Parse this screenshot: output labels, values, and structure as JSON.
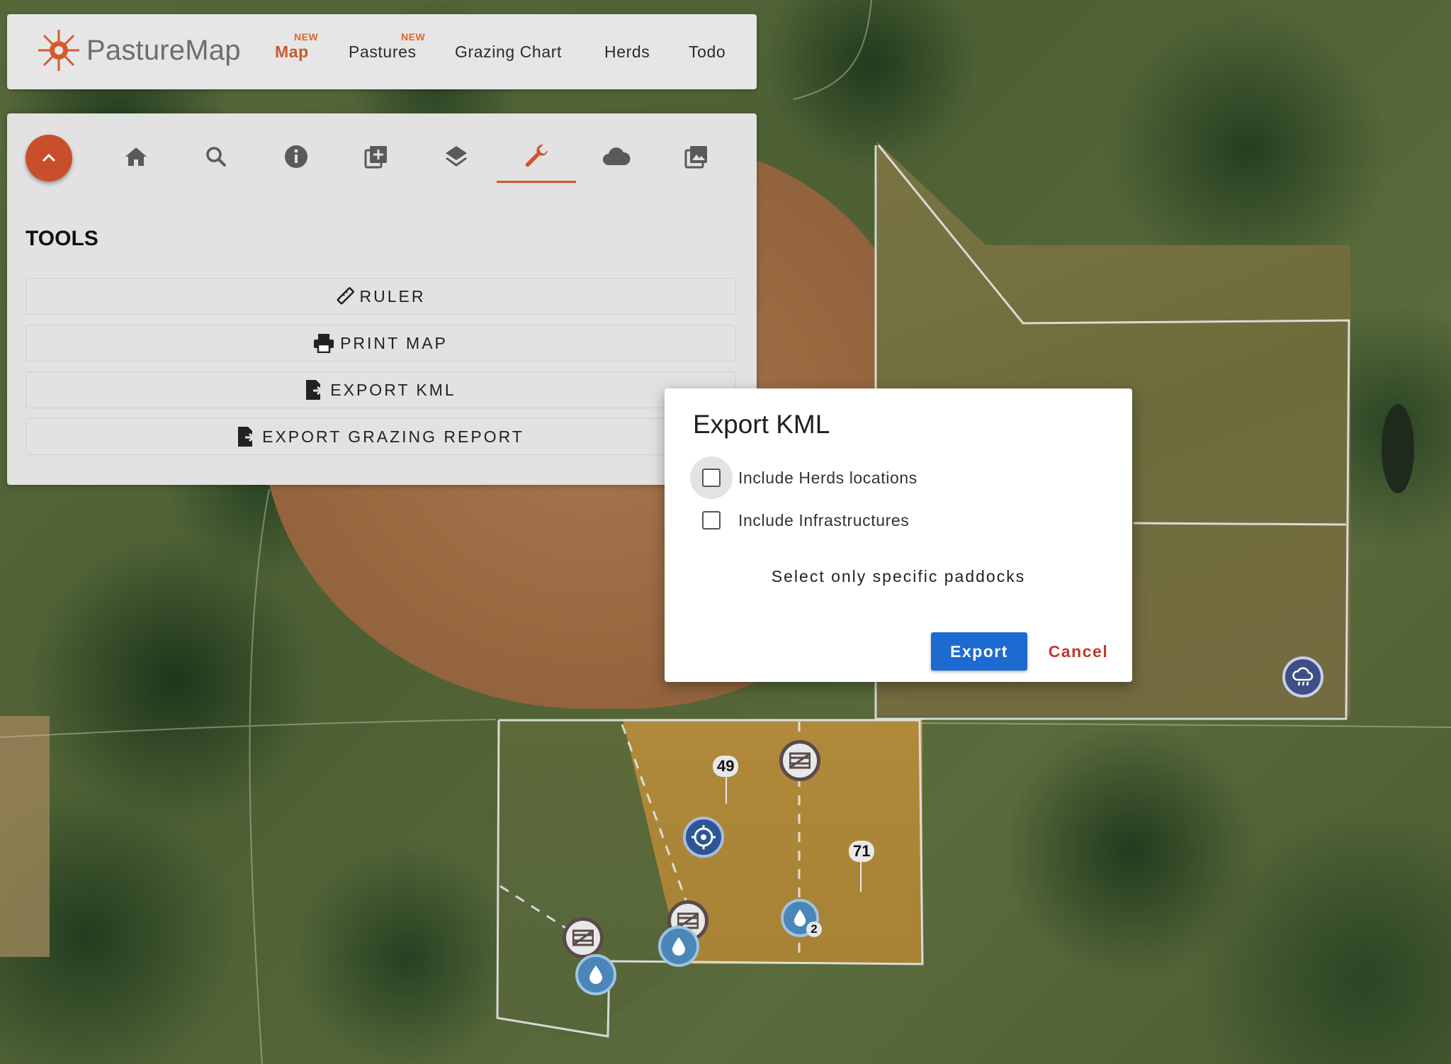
{
  "nav": {
    "logo_text": "PastureMap",
    "items": [
      {
        "label": "Map",
        "badge": "NEW",
        "active": true
      },
      {
        "label": "Pastures",
        "badge": "NEW",
        "active": false
      },
      {
        "label": "Grazing Chart",
        "badge": "",
        "active": false
      },
      {
        "label": "Herds",
        "badge": "",
        "active": false
      },
      {
        "label": "Todo",
        "badge": "",
        "active": false
      }
    ]
  },
  "toolbar": {
    "tabs": [
      "home-icon",
      "search-icon",
      "info-icon",
      "add-layer-icon",
      "layers-icon",
      "wrench-icon",
      "cloud-icon",
      "photo-library-icon"
    ],
    "active_tab": "wrench-icon"
  },
  "tools": {
    "title": "TOOLS",
    "buttons": [
      {
        "label": "RULER",
        "icon": "ruler-icon"
      },
      {
        "label": "PRINT MAP",
        "icon": "printer-icon"
      },
      {
        "label": "EXPORT KML",
        "icon": "file-export-icon"
      },
      {
        "label": "EXPORT GRAZING REPORT",
        "icon": "file-export-icon"
      }
    ]
  },
  "dialog": {
    "title": "Export KML",
    "options": [
      {
        "label": "Include Herds locations",
        "checked": false
      },
      {
        "label": "Include Infrastructures",
        "checked": false
      }
    ],
    "specific_label": "Select only specific paddocks",
    "export_label": "Export",
    "cancel_label": "Cancel"
  },
  "map": {
    "pins": [
      {
        "label": "49"
      },
      {
        "label": "71"
      }
    ],
    "water_count": "2"
  },
  "colors": {
    "brand": "#c45a33",
    "primary_button": "#1d6ad1",
    "cancel": "#c0392b"
  }
}
